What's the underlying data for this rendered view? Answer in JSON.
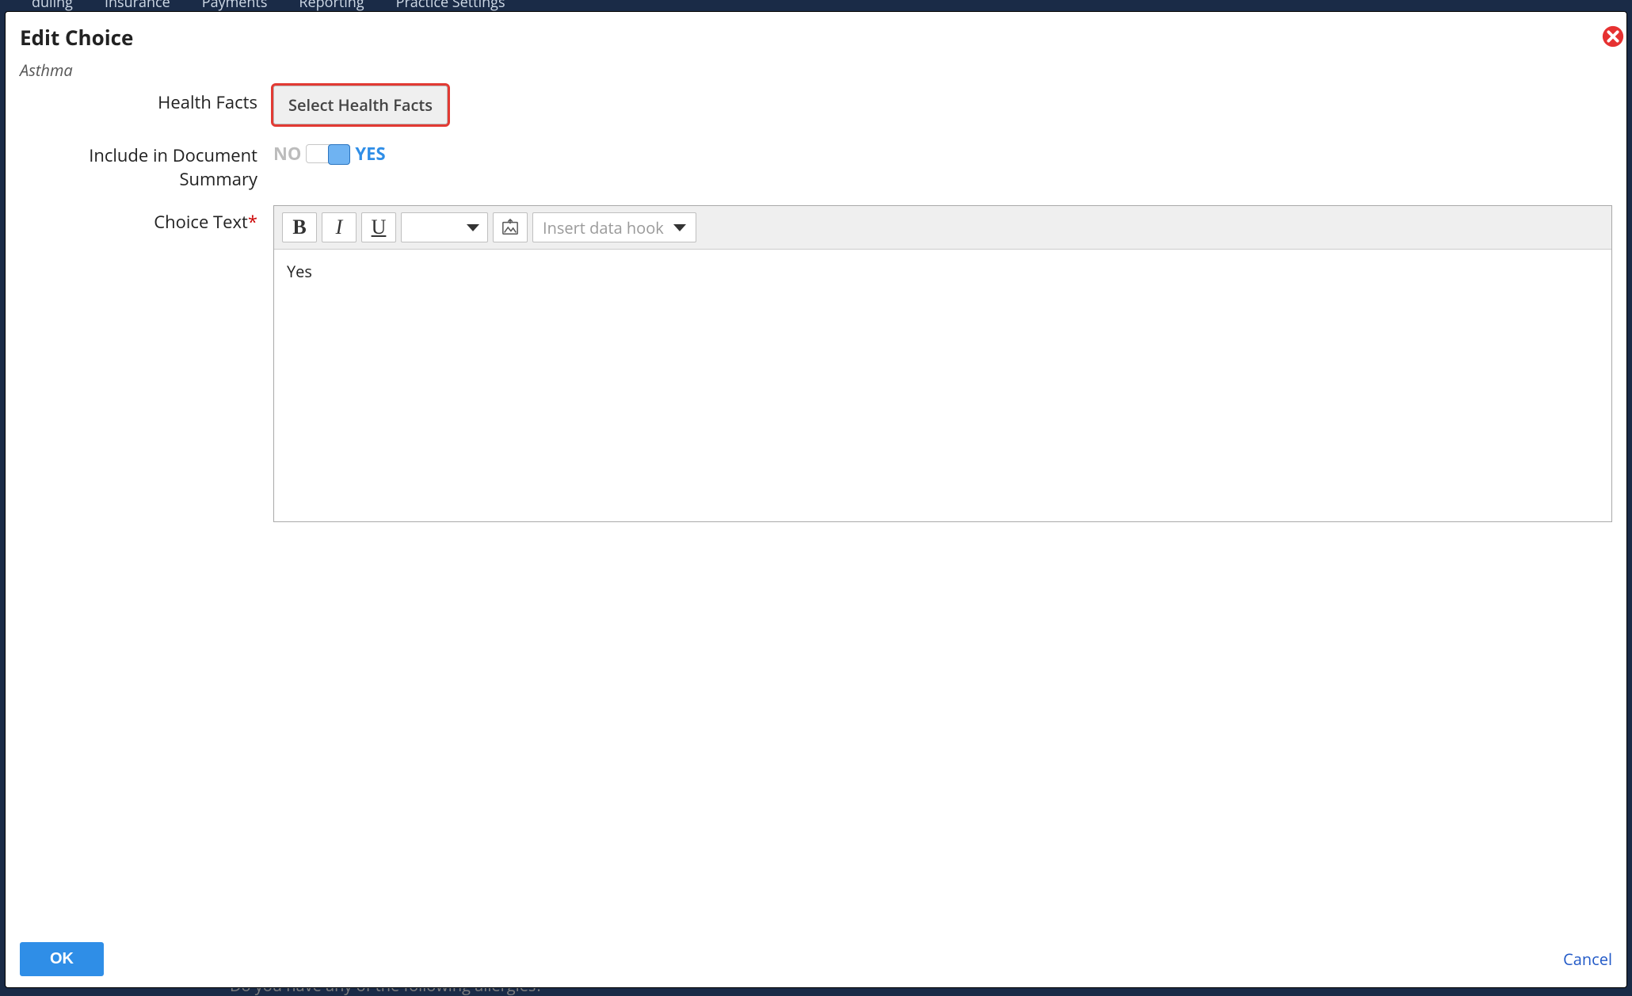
{
  "backgroundNav": [
    "duling",
    "Insurance",
    "Payments",
    "Reporting",
    "Practice Settings"
  ],
  "backgroundText": "Do you have any of the following allergies?",
  "dialog": {
    "title": "Edit Choice",
    "subtitle": "Asthma",
    "fields": {
      "healthFacts": {
        "label": "Health Facts",
        "buttonLabel": "Select Health Facts"
      },
      "includeInSummary": {
        "label": "Include in Document Summary",
        "noLabel": "NO",
        "yesLabel": "YES",
        "value": true
      },
      "choiceText": {
        "label": "Choice Text",
        "required": true,
        "value": "Yes"
      }
    },
    "editorToolbar": {
      "bold": "B",
      "italic": "I",
      "underline": "U",
      "dataHookPlaceholder": "Insert data hook"
    },
    "footer": {
      "okLabel": "OK",
      "cancelLabel": "Cancel"
    }
  }
}
